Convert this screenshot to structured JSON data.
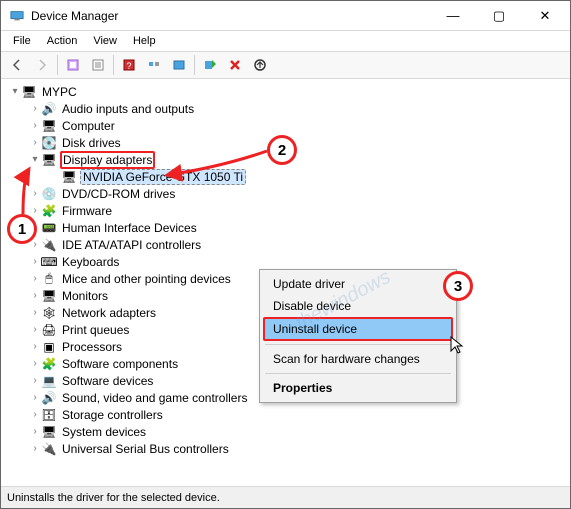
{
  "window": {
    "title": "Device Manager",
    "controls": {
      "min": "—",
      "max": "▢",
      "close": "✕"
    }
  },
  "menubar": {
    "items": [
      "File",
      "Action",
      "View",
      "Help"
    ]
  },
  "toolbar": {
    "back": "back",
    "forward": "forward",
    "show_hidden": "show-hidden",
    "properties": "properties",
    "help": "help",
    "scan": "scan",
    "add": "add-legacy",
    "uninstall": "uninstall",
    "update": "update"
  },
  "tree": {
    "root": "MYPC",
    "items": [
      {
        "label": "Audio inputs and outputs",
        "icon": "🔊"
      },
      {
        "label": "Computer",
        "icon": "🖥"
      },
      {
        "label": "Disk drives",
        "icon": "💽"
      },
      {
        "label": "Display adapters",
        "icon": "🖥",
        "expanded": true,
        "children": [
          {
            "label": "NVIDIA GeForce GTX 1050 Ti",
            "icon": "🖥",
            "selected": true
          }
        ],
        "highlighted": true
      },
      {
        "label": "DVD/CD-ROM drives",
        "icon": "💿"
      },
      {
        "label": "Firmware",
        "icon": "🧩"
      },
      {
        "label": "Human Interface Devices",
        "icon": "📟"
      },
      {
        "label": "IDE ATA/ATAPI controllers",
        "icon": "🔌"
      },
      {
        "label": "Keyboards",
        "icon": "⌨"
      },
      {
        "label": "Mice and other pointing devices",
        "icon": "🖱"
      },
      {
        "label": "Monitors",
        "icon": "🖥"
      },
      {
        "label": "Network adapters",
        "icon": "🕸"
      },
      {
        "label": "Print queues",
        "icon": "🖨"
      },
      {
        "label": "Processors",
        "icon": "▣"
      },
      {
        "label": "Software components",
        "icon": "🧩"
      },
      {
        "label": "Software devices",
        "icon": "💻"
      },
      {
        "label": "Sound, video and game controllers",
        "icon": "🔊"
      },
      {
        "label": "Storage controllers",
        "icon": "🗄"
      },
      {
        "label": "System devices",
        "icon": "🖥"
      },
      {
        "label": "Universal Serial Bus controllers",
        "icon": "🔌"
      }
    ]
  },
  "context_menu": {
    "items": [
      {
        "label": "Update driver"
      },
      {
        "label": "Disable device"
      },
      {
        "label": "Uninstall device",
        "selected": true
      },
      {
        "separator": true
      },
      {
        "label": "Scan for hardware changes"
      },
      {
        "separator": true
      },
      {
        "label": "Properties",
        "bold": true
      }
    ]
  },
  "statusbar": {
    "text": "Uninstalls the driver for the selected device."
  },
  "annotations": {
    "a1": "1",
    "a2": "2",
    "a3": "3"
  },
  "root_icon": "🖥"
}
